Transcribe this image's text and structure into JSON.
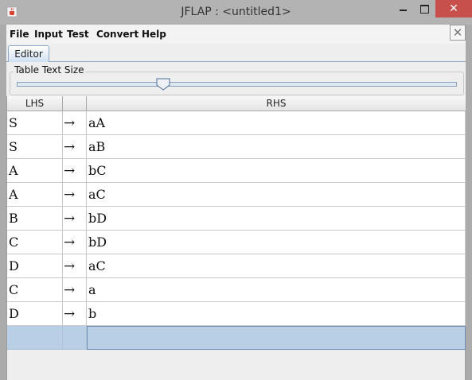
{
  "window": {
    "title": "JFLAP : <untitled1>",
    "minimize": "—",
    "close": "✕",
    "close_inner": "✕"
  },
  "menu": [
    "File",
    "Input",
    "Test",
    "Convert",
    "Help"
  ],
  "tab": "Editor",
  "slider": {
    "label": "Table Text Size",
    "value_fraction": 0.34
  },
  "table": {
    "headers": [
      "LHS",
      "",
      "RHS"
    ],
    "arrow": "→",
    "rows": [
      {
        "lhs": "S",
        "rhs": "aA"
      },
      {
        "lhs": "S",
        "rhs": "aB"
      },
      {
        "lhs": "A",
        "rhs": "bC"
      },
      {
        "lhs": "A",
        "rhs": "aC"
      },
      {
        "lhs": "B",
        "rhs": "bD"
      },
      {
        "lhs": "C",
        "rhs": "bD"
      },
      {
        "lhs": "D",
        "rhs": "aC"
      },
      {
        "lhs": "C",
        "rhs": "a"
      },
      {
        "lhs": "D",
        "rhs": "b"
      }
    ]
  },
  "colors": {
    "selection": "#b8cfe5",
    "close_button": "#c7504c",
    "title_bar": "#b3b3b3"
  }
}
